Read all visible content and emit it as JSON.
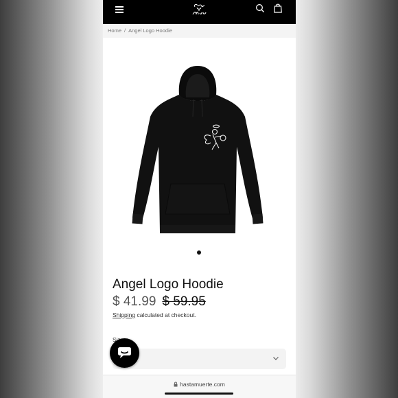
{
  "header": {
    "menu_icon": "hamburger-menu-icon",
    "logo_icon": "muerte-angel-logo",
    "search_icon": "search-icon",
    "cart_icon": "shopping-bag-icon",
    "background": "#000000"
  },
  "breadcrumb": {
    "home": "Home",
    "separator": "/",
    "current": "Angel Logo Hoodie"
  },
  "gallery": {
    "slide_count": 1,
    "active_slide": 1
  },
  "product": {
    "title": "Angel Logo Hoodie",
    "price": "$ 41.99",
    "compare_at_price": "$ 59.95",
    "shipping_note_prefix": "Shipping",
    "shipping_note_suffix": " calculated at checkout.",
    "size_label": "Siz",
    "size_selected": ""
  },
  "chat": {
    "icon": "chat-bubble-icon"
  },
  "browser": {
    "url": "hastamuerte.com",
    "lock_icon": "lock-icon"
  }
}
